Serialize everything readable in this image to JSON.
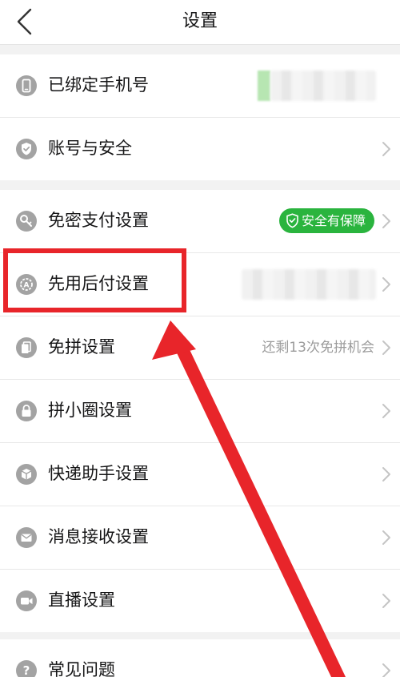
{
  "header": {
    "title": "设置"
  },
  "group1": {
    "items": [
      {
        "label": "已绑定手机号"
      },
      {
        "label": "账号与安全"
      }
    ]
  },
  "group2": {
    "items": [
      {
        "label": "免密支付设置",
        "badge": "安全有保障"
      },
      {
        "label": "先用后付设置"
      },
      {
        "label": "免拼设置",
        "value": "还剩13次免拼机会"
      },
      {
        "label": "拼小圈设置"
      },
      {
        "label": "快递助手设置"
      },
      {
        "label": "消息接收设置"
      },
      {
        "label": "直播设置"
      }
    ]
  },
  "group3": {
    "items": [
      {
        "label": "常见问题"
      }
    ]
  },
  "colors": {
    "badge_green": "#2ab43e",
    "highlight_red": "#e8252a",
    "icon_gray": "#a3a3a3"
  }
}
